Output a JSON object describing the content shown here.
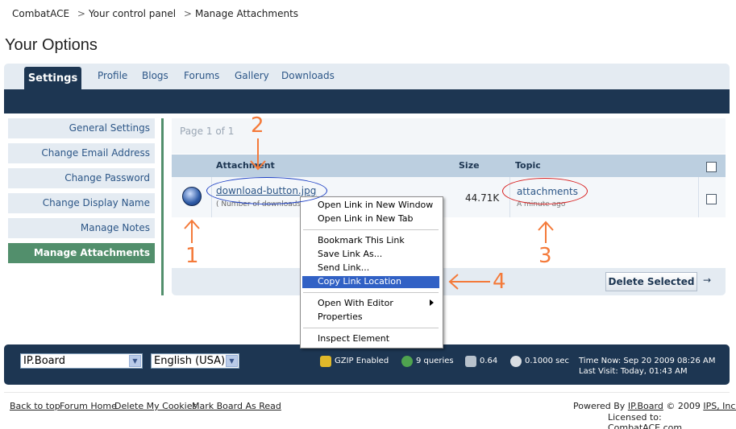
{
  "breadcrumb": [
    "CombatACE",
    "Your control panel",
    "Manage Attachments"
  ],
  "breadcrumb_sep": ">",
  "page_title": "Your Options",
  "tabs": {
    "active": "Settings",
    "items": [
      "Profile",
      "Blogs",
      "Forums",
      "Gallery",
      "Downloads"
    ]
  },
  "sidebar": {
    "items": [
      "General Settings",
      "Change Email Address",
      "Change Password",
      "Change Display Name",
      "Manage Notes",
      "Manage Attachments"
    ],
    "active_index": 5
  },
  "content": {
    "pagination": "Page 1 of 1",
    "columns": {
      "attachment": "Attachment",
      "size": "Size",
      "topic": "Topic"
    },
    "row": {
      "filename": "download-button.jpg",
      "subtext": "( Number of downloads",
      "size": "44.71K",
      "topic": "attachments",
      "time": "A minute ago"
    },
    "delete_button": "Delete Selected",
    "go_arrow": "→"
  },
  "context_menu": {
    "groups": [
      [
        "Open Link in New Window",
        "Open Link in New Tab"
      ],
      [
        "Bookmark This Link",
        "Save Link As...",
        "Send Link...",
        "Copy Link Location"
      ],
      [
        "Open With Editor",
        "Properties"
      ],
      [
        "Inspect Element"
      ]
    ],
    "highlighted": "Copy Link Location"
  },
  "annotations": [
    "1",
    "2",
    "3",
    "4"
  ],
  "bottom_bar": {
    "skin_select": "IP.Board",
    "lang_select": "English (USA)",
    "stats": {
      "gzip": "GZIP Enabled",
      "queries": "9 queries",
      "load": "0.64",
      "time": "0.1000 sec"
    },
    "time_now": "Time Now: Sep 20 2009 08:26 AM",
    "last_visit": "Last Visit: Today, 01:43 AM"
  },
  "footer": {
    "links": [
      "Back to top",
      "Forum Home",
      "Delete My Cookies",
      "Mark Board As Read"
    ],
    "powered_prefix": "Powered By",
    "powered_link": "IP.Board",
    "copyright": "© 2009",
    "company_link": "IPS, Inc.",
    "licensed": "Licensed to: CombatACE.com"
  },
  "colors": {
    "nav_dark": "#1d3652",
    "active_green": "#528f6c",
    "light_blue": "#e4ebf2",
    "annotation_orange": "#f47a3a",
    "highlight_blue": "#3161c5"
  }
}
